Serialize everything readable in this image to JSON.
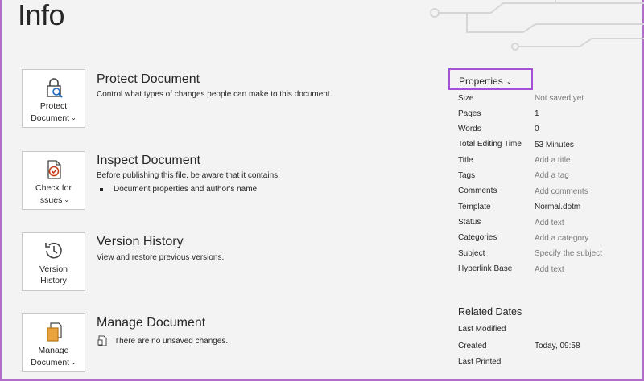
{
  "page": {
    "title": "Info"
  },
  "sections": {
    "protect": {
      "button_line1": "Protect",
      "button_line2": "Document",
      "title": "Protect Document",
      "description": "Control what types of changes people can make to this document."
    },
    "inspect": {
      "button_line1": "Check for",
      "button_line2": "Issues",
      "title": "Inspect Document",
      "description": "Before publishing this file, be aware that it contains:",
      "bullets": [
        "Document properties and author's name"
      ]
    },
    "version": {
      "button_line1": "Version",
      "button_line2": "History",
      "title": "Version History",
      "description": "View and restore previous versions."
    },
    "manage": {
      "button_line1": "Manage",
      "button_line2": "Document",
      "title": "Manage Document",
      "description": "There are no unsaved changes."
    }
  },
  "properties": {
    "header": "Properties",
    "rows": [
      {
        "label": "Size",
        "value": "Not saved yet"
      },
      {
        "label": "Pages",
        "value": "1"
      },
      {
        "label": "Words",
        "value": "0"
      },
      {
        "label": "Total Editing Time",
        "value": "53 Minutes"
      },
      {
        "label": "Title",
        "value": "Add a title"
      },
      {
        "label": "Tags",
        "value": "Add a tag"
      },
      {
        "label": "Comments",
        "value": "Add comments"
      },
      {
        "label": "Template",
        "value": "Normal.dotm"
      },
      {
        "label": "Status",
        "value": "Add text"
      },
      {
        "label": "Categories",
        "value": "Add a category"
      },
      {
        "label": "Subject",
        "value": "Specify the subject"
      },
      {
        "label": "Hyperlink Base",
        "value": "Add text"
      }
    ]
  },
  "related_dates": {
    "title": "Related Dates",
    "rows": [
      {
        "label": "Last Modified",
        "value": ""
      },
      {
        "label": "Created",
        "value": "Today, 09:58"
      },
      {
        "label": "Last Printed",
        "value": ""
      }
    ]
  },
  "colors": {
    "accent": "#a64fd9",
    "placeholder_text": "#7a7a7a",
    "icon_blue": "#1f6bc1",
    "icon_red": "#c43e1c",
    "icon_orange": "#e8a33d"
  },
  "icons": {
    "protect": "lock-search-icon",
    "inspect": "document-check-icon",
    "version": "clock-history-icon",
    "manage": "document-stack-icon",
    "manage_row": "document-small-icon"
  }
}
